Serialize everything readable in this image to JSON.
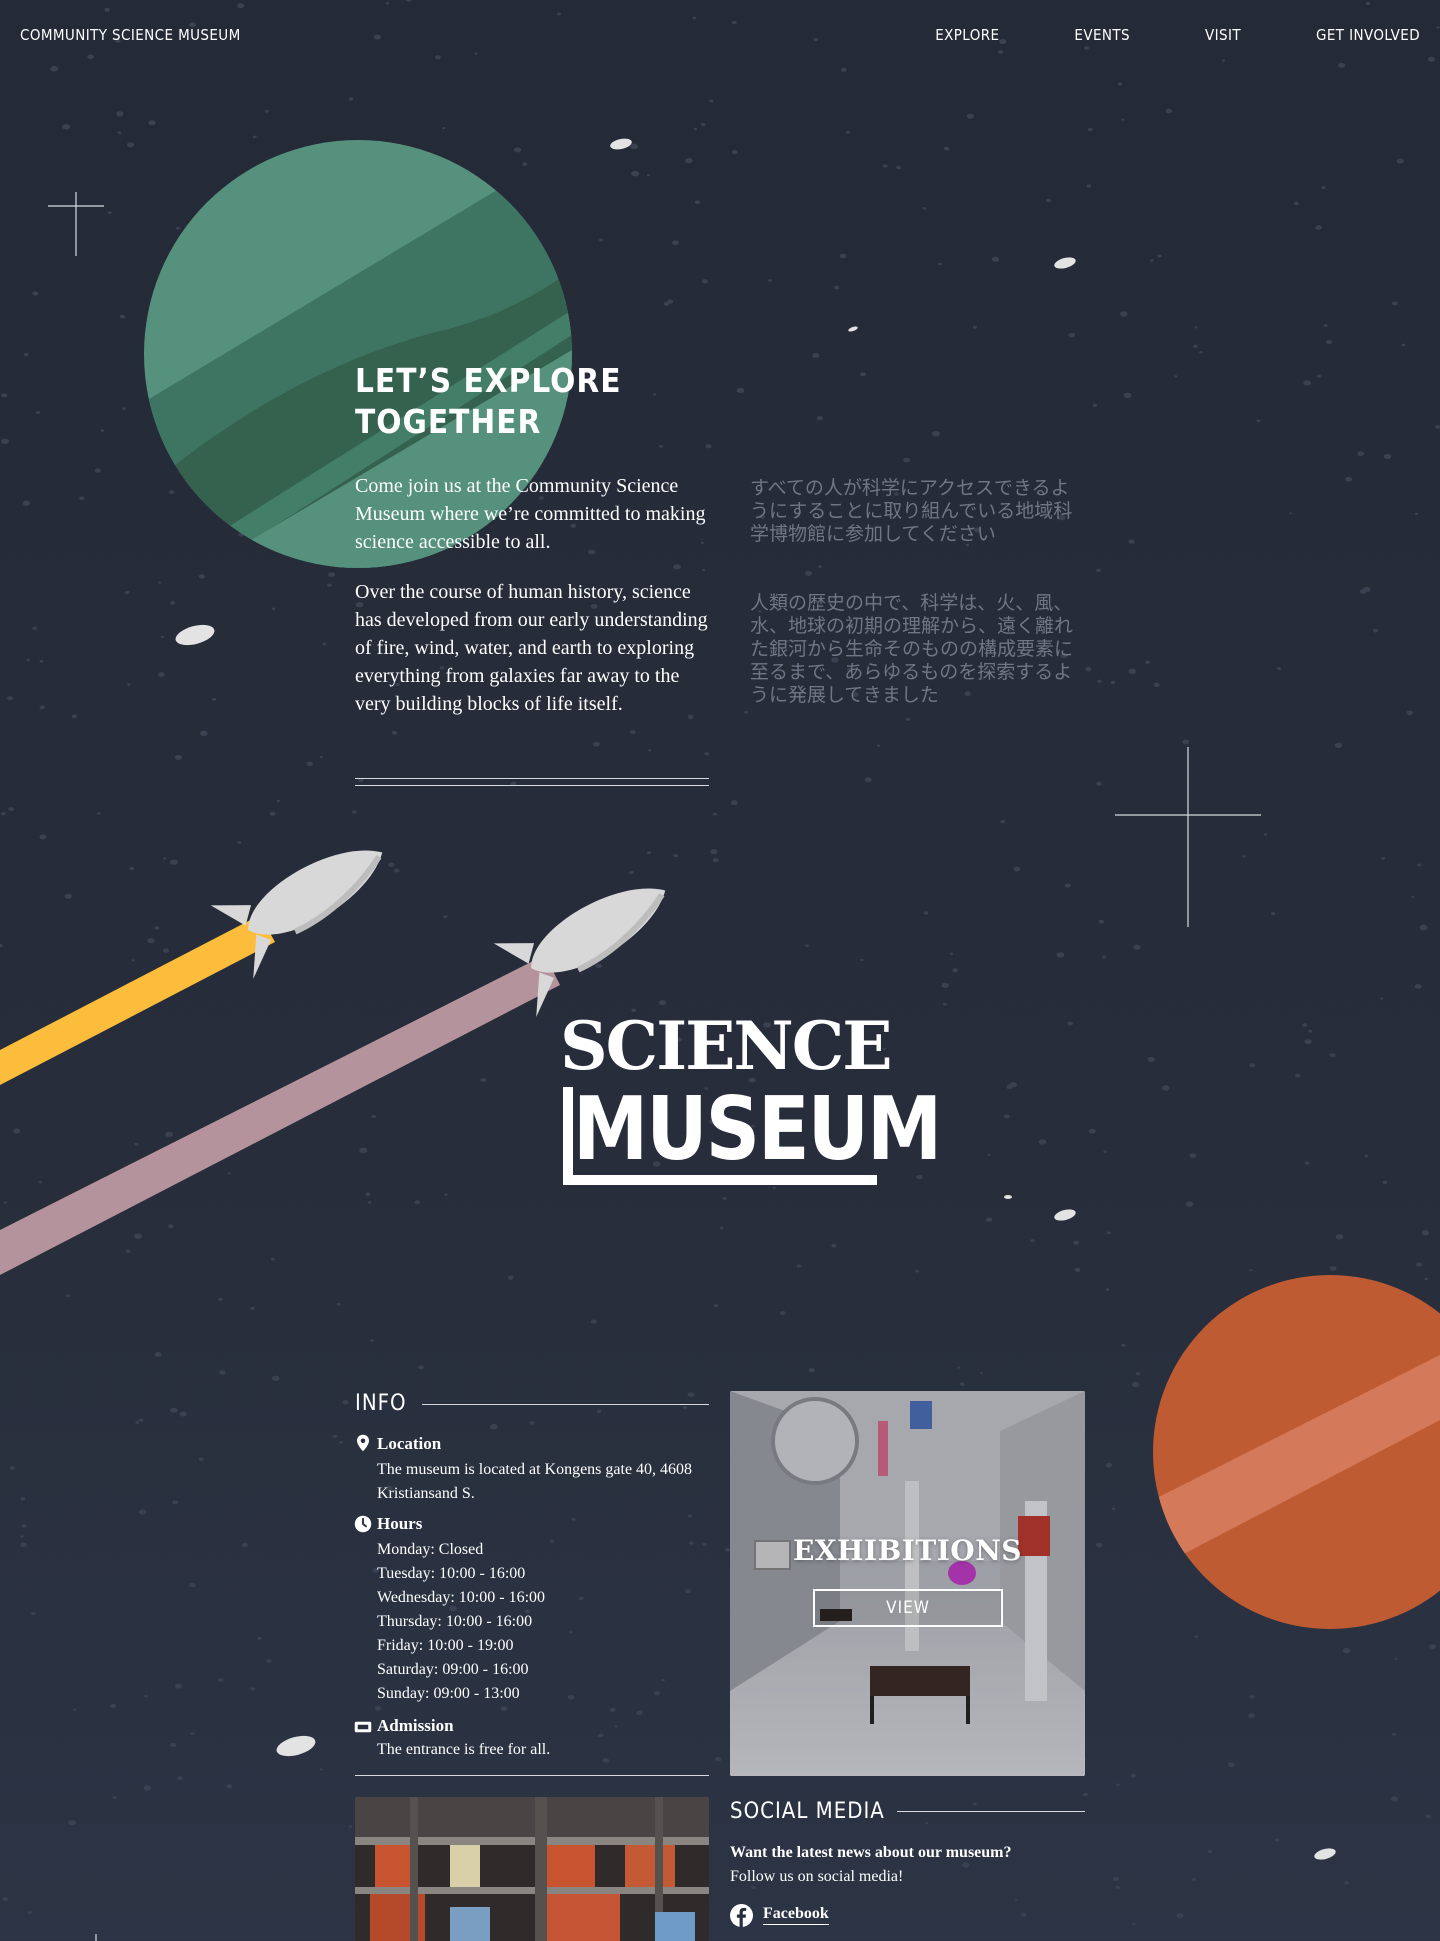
{
  "nav": {
    "brand": "COMMUNITY SCIENCE MUSEUM",
    "links": [
      "EXPLORE",
      "EVENTS",
      "VISIT",
      "GET INVOLVED"
    ]
  },
  "hero": {
    "title_line1": "LET’S EXPLORE",
    "title_line2": "TOGETHER",
    "paragraph1": "Come join us at the Community Science Museum where we’re committed to making science accessible to all.",
    "paragraph2": "Over the course of human history, science has developed from our early understanding of fire, wind, water, and earth to exploring everything from galaxies far away to the very building blocks of life itself.",
    "jp_paragraph1": "すべての人が科学にアクセスできるようにすることに取り組んでいる地域科学博物館に参加してください",
    "jp_paragraph2": "人類の歴史の中で、科学は、火、風、水、地球の初期の理解から、遠く離れた銀河から生命そのものの構成要素に至るまで、あらゆるものを探索するように発展してきました"
  },
  "logo": {
    "line1": "SCIENCE",
    "line2": "MUSEUM"
  },
  "info": {
    "heading": "INFO",
    "location_label": "Location",
    "location_text": "The museum is located at Kongens gate 40, 4608 Kristiansand S.",
    "hours_label": "Hours",
    "hours": [
      "Monday: Closed",
      "Tuesday: 10:00 - 16:00",
      "Wednesday: 10:00 - 16:00",
      "Thursday: 10:00 - 16:00",
      "Friday: 10:00 - 19:00",
      "Saturday: 09:00 - 16:00",
      "Sunday: 09:00 - 13:00"
    ],
    "admission_label": "Admission",
    "admission_text": "The entrance is free for all."
  },
  "exhibitions": {
    "title": "EXHIBITIONS",
    "button": "VIEW"
  },
  "social": {
    "heading": "SOCIAL MEDIA",
    "lead": "Want the latest news about our museum?",
    "text": "Follow us on social media!",
    "facebook": "Facebook"
  },
  "colors": {
    "background": "#262c38",
    "green_planet": "#4e8f7a",
    "orange_planet": "#c25c34",
    "rocket_trail_yellow": "#fbbd3b",
    "rocket_trail_pink": "#b4939c"
  },
  "icons": [
    "location-pin-icon",
    "clock-icon",
    "ticket-icon",
    "facebook-icon"
  ]
}
